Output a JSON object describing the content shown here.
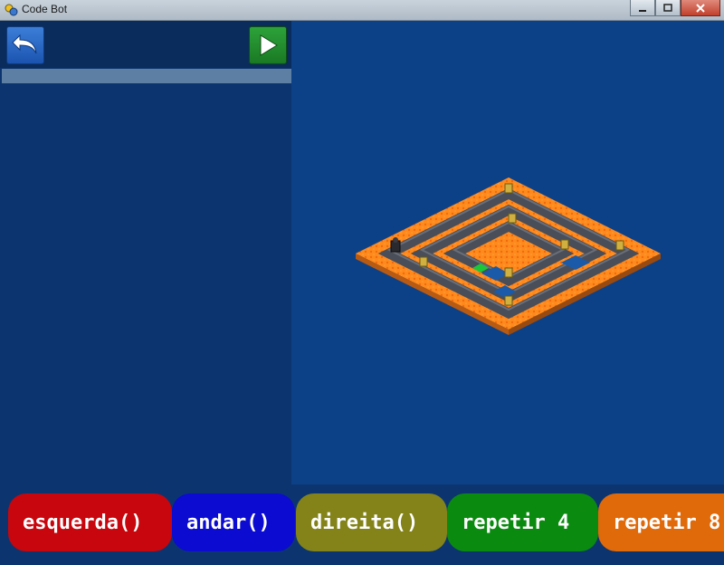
{
  "window": {
    "title": "Code Bot"
  },
  "colors": {
    "lava": "#ff8a1c",
    "path": "#4a4e58",
    "background": "#0c4188",
    "esquerda": "#c8060d",
    "andar": "#0b0bd1",
    "direita": "#83831a",
    "repetir4": "#0b8a10",
    "repetir8": "#e06a0a"
  },
  "toolbar": {
    "back_icon": "undo-arrow-icon",
    "play_icon": "play-icon"
  },
  "commands": [
    {
      "label": "esquerda()"
    },
    {
      "label": "andar()"
    },
    {
      "label": "direita()"
    },
    {
      "label": "repetir 4"
    },
    {
      "label": "repetir 8"
    }
  ]
}
